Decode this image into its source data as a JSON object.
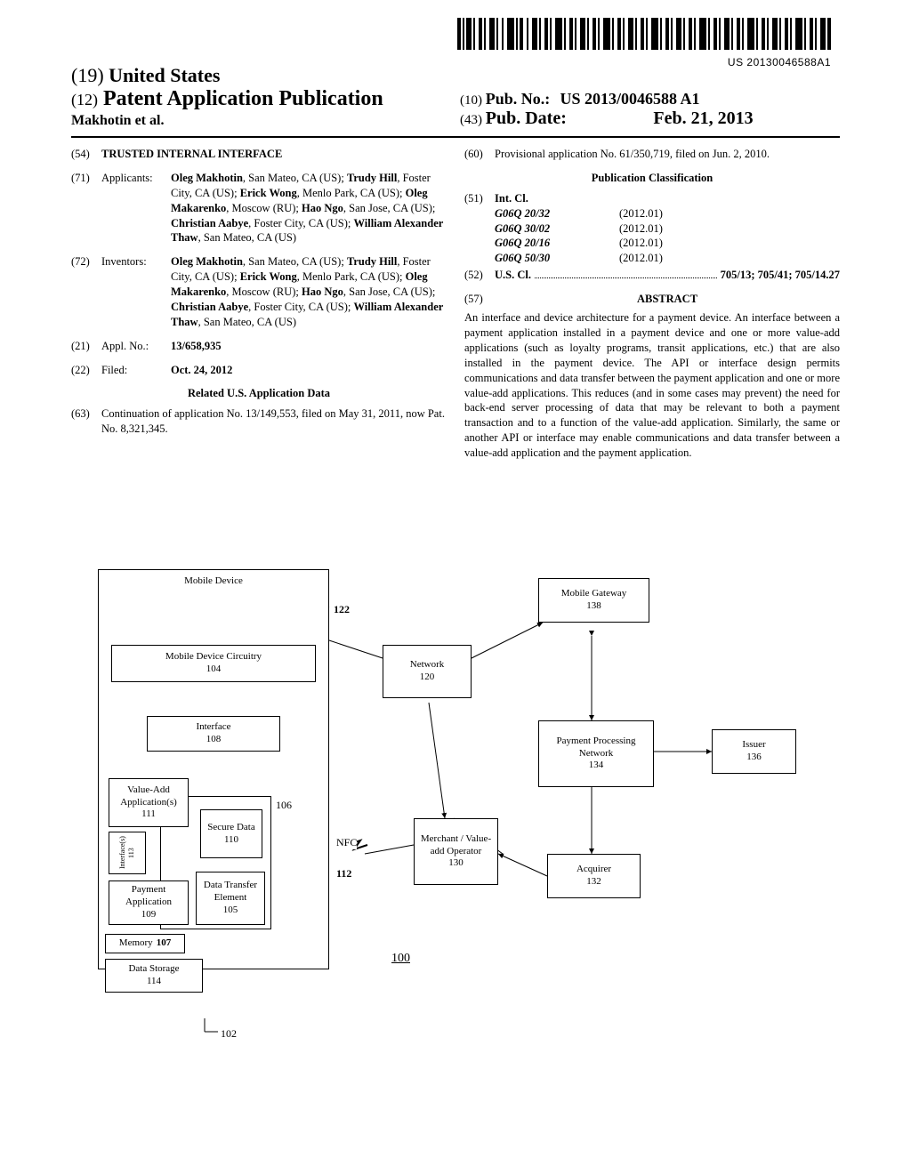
{
  "barcode_text": "US 20130046588A1",
  "header": {
    "line19_prefix": "(19)",
    "line19_text": "United States",
    "line12_prefix": "(12)",
    "line12_text": "Patent Application Publication",
    "authors": "Makhotin et al.",
    "pubno_prefix": "(10)",
    "pubno_label": "Pub. No.:",
    "pubno_value": "US 2013/0046588 A1",
    "pubdate_prefix": "(43)",
    "pubdate_label": "Pub. Date:",
    "pubdate_value": "Feb. 21, 2013"
  },
  "left_col": {
    "f54": {
      "num": "(54)",
      "label": "",
      "value": "TRUSTED INTERNAL INTERFACE"
    },
    "f71": {
      "num": "(71)",
      "label": "Applicants:",
      "people": [
        {
          "name": "Oleg Makhotin",
          "loc": "San Mateo, CA (US)"
        },
        {
          "name": "Trudy Hill",
          "loc": "Foster City, CA (US)"
        },
        {
          "name": "Erick Wong",
          "loc": "Menlo Park, CA (US)"
        },
        {
          "name": "Oleg Makarenko",
          "loc": "Moscow (RU)"
        },
        {
          "name": "Hao Ngo",
          "loc": "San Jose, CA (US)"
        },
        {
          "name": "Christian Aabye",
          "loc": "Foster City, CA (US)"
        },
        {
          "name": "William Alexander Thaw",
          "loc": "San Mateo, CA (US)"
        }
      ]
    },
    "f72": {
      "num": "(72)",
      "label": "Inventors:",
      "people": [
        {
          "name": "Oleg Makhotin",
          "loc": "San Mateo, CA (US)"
        },
        {
          "name": "Trudy Hill",
          "loc": "Foster City, CA (US)"
        },
        {
          "name": "Erick Wong",
          "loc": "Menlo Park, CA (US)"
        },
        {
          "name": "Oleg Makarenko",
          "loc": "Moscow (RU)"
        },
        {
          "name": "Hao Ngo",
          "loc": "San Jose, CA (US)"
        },
        {
          "name": "Christian Aabye",
          "loc": "Foster City, CA (US)"
        },
        {
          "name": "William Alexander Thaw",
          "loc": "San Mateo, CA (US)"
        }
      ]
    },
    "f21": {
      "num": "(21)",
      "label": "Appl. No.:",
      "value": "13/658,935"
    },
    "f22": {
      "num": "(22)",
      "label": "Filed:",
      "value": "Oct. 24, 2012"
    },
    "related_title": "Related U.S. Application Data",
    "f63": {
      "num": "(63)",
      "label": "",
      "value": "Continuation of application No. 13/149,553, filed on May 31, 2011, now Pat. No. 8,321,345."
    }
  },
  "right_col": {
    "f60": {
      "num": "(60)",
      "label": "",
      "value": "Provisional application No. 61/350,719, filed on Jun. 2, 2010."
    },
    "pubclass_title": "Publication Classification",
    "f51": {
      "num": "(51)",
      "label": "Int. Cl.",
      "rows": [
        {
          "code": "G06Q 20/32",
          "date": "(2012.01)"
        },
        {
          "code": "G06Q 30/02",
          "date": "(2012.01)"
        },
        {
          "code": "G06Q 20/16",
          "date": "(2012.01)"
        },
        {
          "code": "G06Q 50/30",
          "date": "(2012.01)"
        }
      ]
    },
    "f52": {
      "num": "(52)",
      "label": "U.S. Cl.",
      "value": "705/13; 705/41; 705/14.27"
    },
    "f57": {
      "num": "(57)",
      "title": "ABSTRACT"
    },
    "abstract": "An interface and device architecture for a payment device. An interface between a payment application installed in a payment device and one or more value-add applications (such as loyalty programs, transit applications, etc.) that are also installed in the payment device. The API or interface design permits communications and data transfer between the payment application and one or more value-add applications. This reduces (and in some cases may prevent) the need for back-end server processing of data that may be relevant to both a payment transaction and to a function of the value-add application. Similarly, the same or another API or interface may enable communications and data transfer between a value-add application and the payment application."
  },
  "diagram": {
    "mobile_device": "Mobile Device",
    "circuitry": "Mobile Device Circuitry",
    "circuitry_n": "104",
    "interface": "Interface",
    "interface_n": "108",
    "valueadd": "Value-Add Application(s)",
    "valueadd_n": "111",
    "interfaces_side": "Interface(s)",
    "interfaces_side_n": "113",
    "secure": "Secure Data",
    "secure_n": "110",
    "payment_app": "Payment Application",
    "payment_app_n": "109",
    "dte": "Data Transfer Element",
    "dte_n": "105",
    "memory": "Memory",
    "memory_n": "107",
    "datastore": "Data Storage",
    "datastore_n": "114",
    "label_106": "106",
    "label_102": "102",
    "label_122": "122",
    "nfc": "NFC",
    "label_112": "112",
    "network": "Network",
    "network_n": "120",
    "merchant": "Merchant / Value-add Operator",
    "merchant_n": "130",
    "gateway": "Mobile Gateway",
    "gateway_n": "138",
    "ppn": "Payment Processing Network",
    "ppn_n": "134",
    "issuer": "Issuer",
    "issuer_n": "136",
    "acquirer": "Acquirer",
    "acquirer_n": "132",
    "fignum": "100"
  }
}
